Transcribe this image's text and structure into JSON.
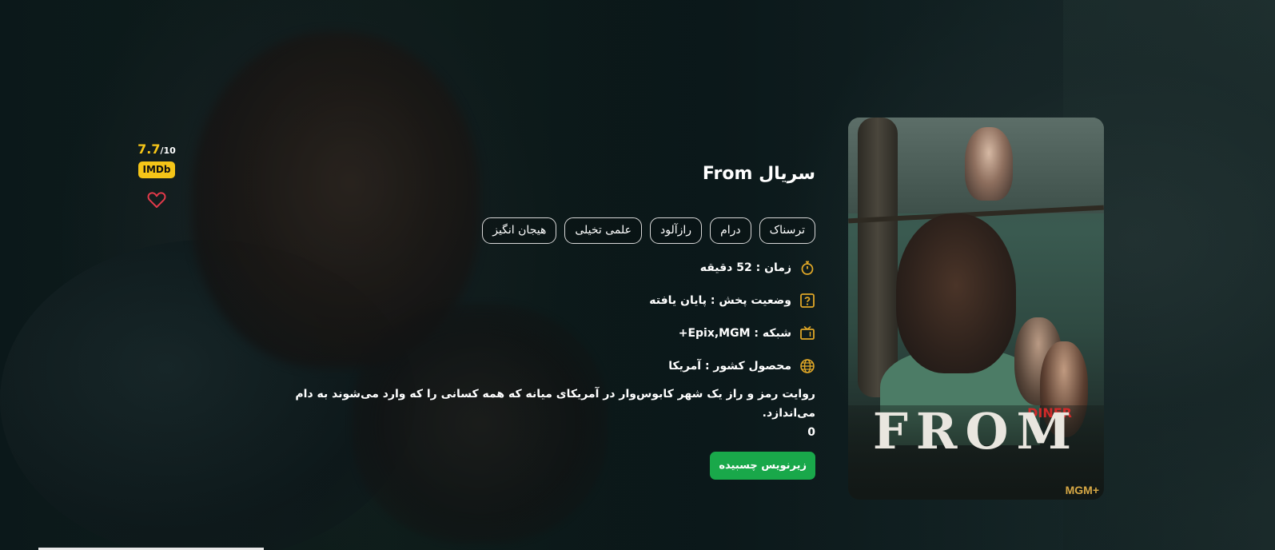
{
  "rating": {
    "score": "7.7",
    "max": "/10",
    "badge": "IMDb"
  },
  "title": "سریال From",
  "genres": [
    "ترسناک",
    "درام",
    "رازآلود",
    "علمی تخیلی",
    "هیجان انگیز"
  ],
  "meta": {
    "duration": "زمان : 52 دقیقه",
    "status": "وضعیت پخش : پایان یافته",
    "network": "شبکه : Epix,MGM+",
    "country": "محصول کشور : آمریکا"
  },
  "description": "روایت رمز و راز یک شهر کابوس‌وار در آمریکای میانه که همه کسانی را که وارد می‌شوند به دام می‌اندازد.",
  "description_extra": "0",
  "subtitle_button": "زیرنویس چسبیده",
  "poster": {
    "logo_text": "FROM",
    "brand": "MGM+",
    "sign": "DINER"
  },
  "colors": {
    "accent_gold": "#f5c518",
    "button_green": "#19a84a",
    "icon_gold": "#e0a727"
  }
}
